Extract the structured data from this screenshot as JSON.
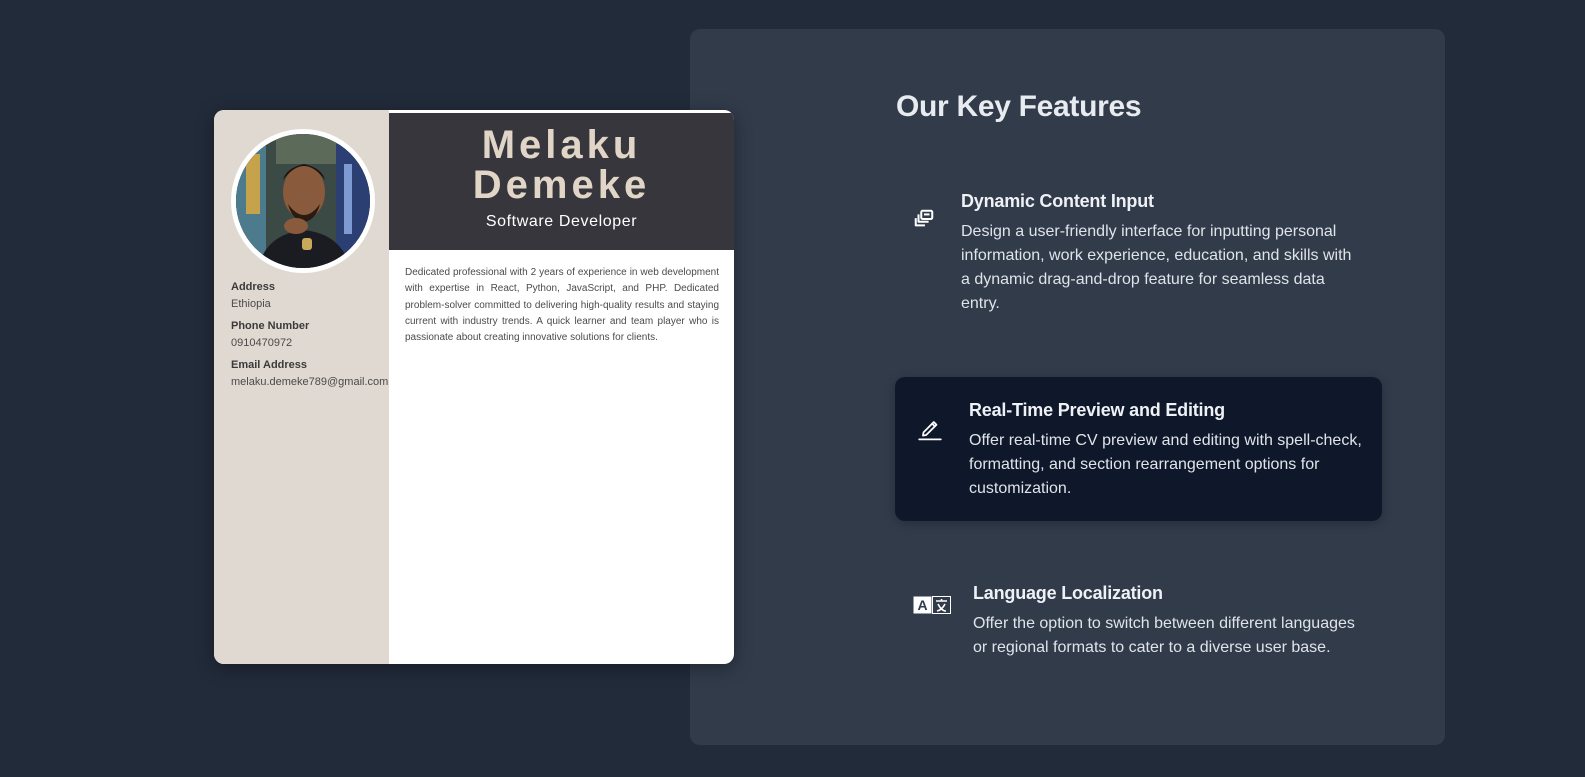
{
  "cv_preview": {
    "name_first": "Melaku",
    "name_last": "Demeke",
    "role": "Software Developer",
    "contact": [
      {
        "label": "Address",
        "value": "Ethiopia"
      },
      {
        "label": "Phone Number",
        "value": "0910470972"
      },
      {
        "label": "Email Address",
        "value": "melaku.demeke789@gmail.com"
      }
    ],
    "summary": "Dedicated professional with 2 years of experience in web development with expertise in React, Python, JavaScript, and PHP. Dedicated problem-solver committed to delivering high-quality results and staying current with industry trends. A quick learner and team player who is passionate about creating innovative solutions for clients.",
    "colors": {
      "sidebar": "#e0d9d1",
      "header": "#36363c",
      "name": "#e0d5c6"
    }
  },
  "features": {
    "title": "Our Key Features",
    "items": [
      {
        "icon": "copy-stack-icon",
        "title": "Dynamic Content Input",
        "description": "Design a user-friendly interface for inputting personal information, work experience, education, and skills with a dynamic drag-and-drop feature for seamless data entry.",
        "active": false
      },
      {
        "icon": "pencil-icon",
        "title": "Real-Time Preview and Editing",
        "description": "Offer real-time CV preview and editing with spell-check, formatting, and section rearrangement options for customization.",
        "active": true
      },
      {
        "icon": "translate-icon",
        "title": "Language Localization",
        "description": "Offer the option to switch between different languages or regional formats to cater to a diverse user base.",
        "active": false
      }
    ],
    "colors": {
      "page_bg": "#222b3a",
      "panel_bg": "#313b4a",
      "active_bg": "#0f172a"
    }
  }
}
